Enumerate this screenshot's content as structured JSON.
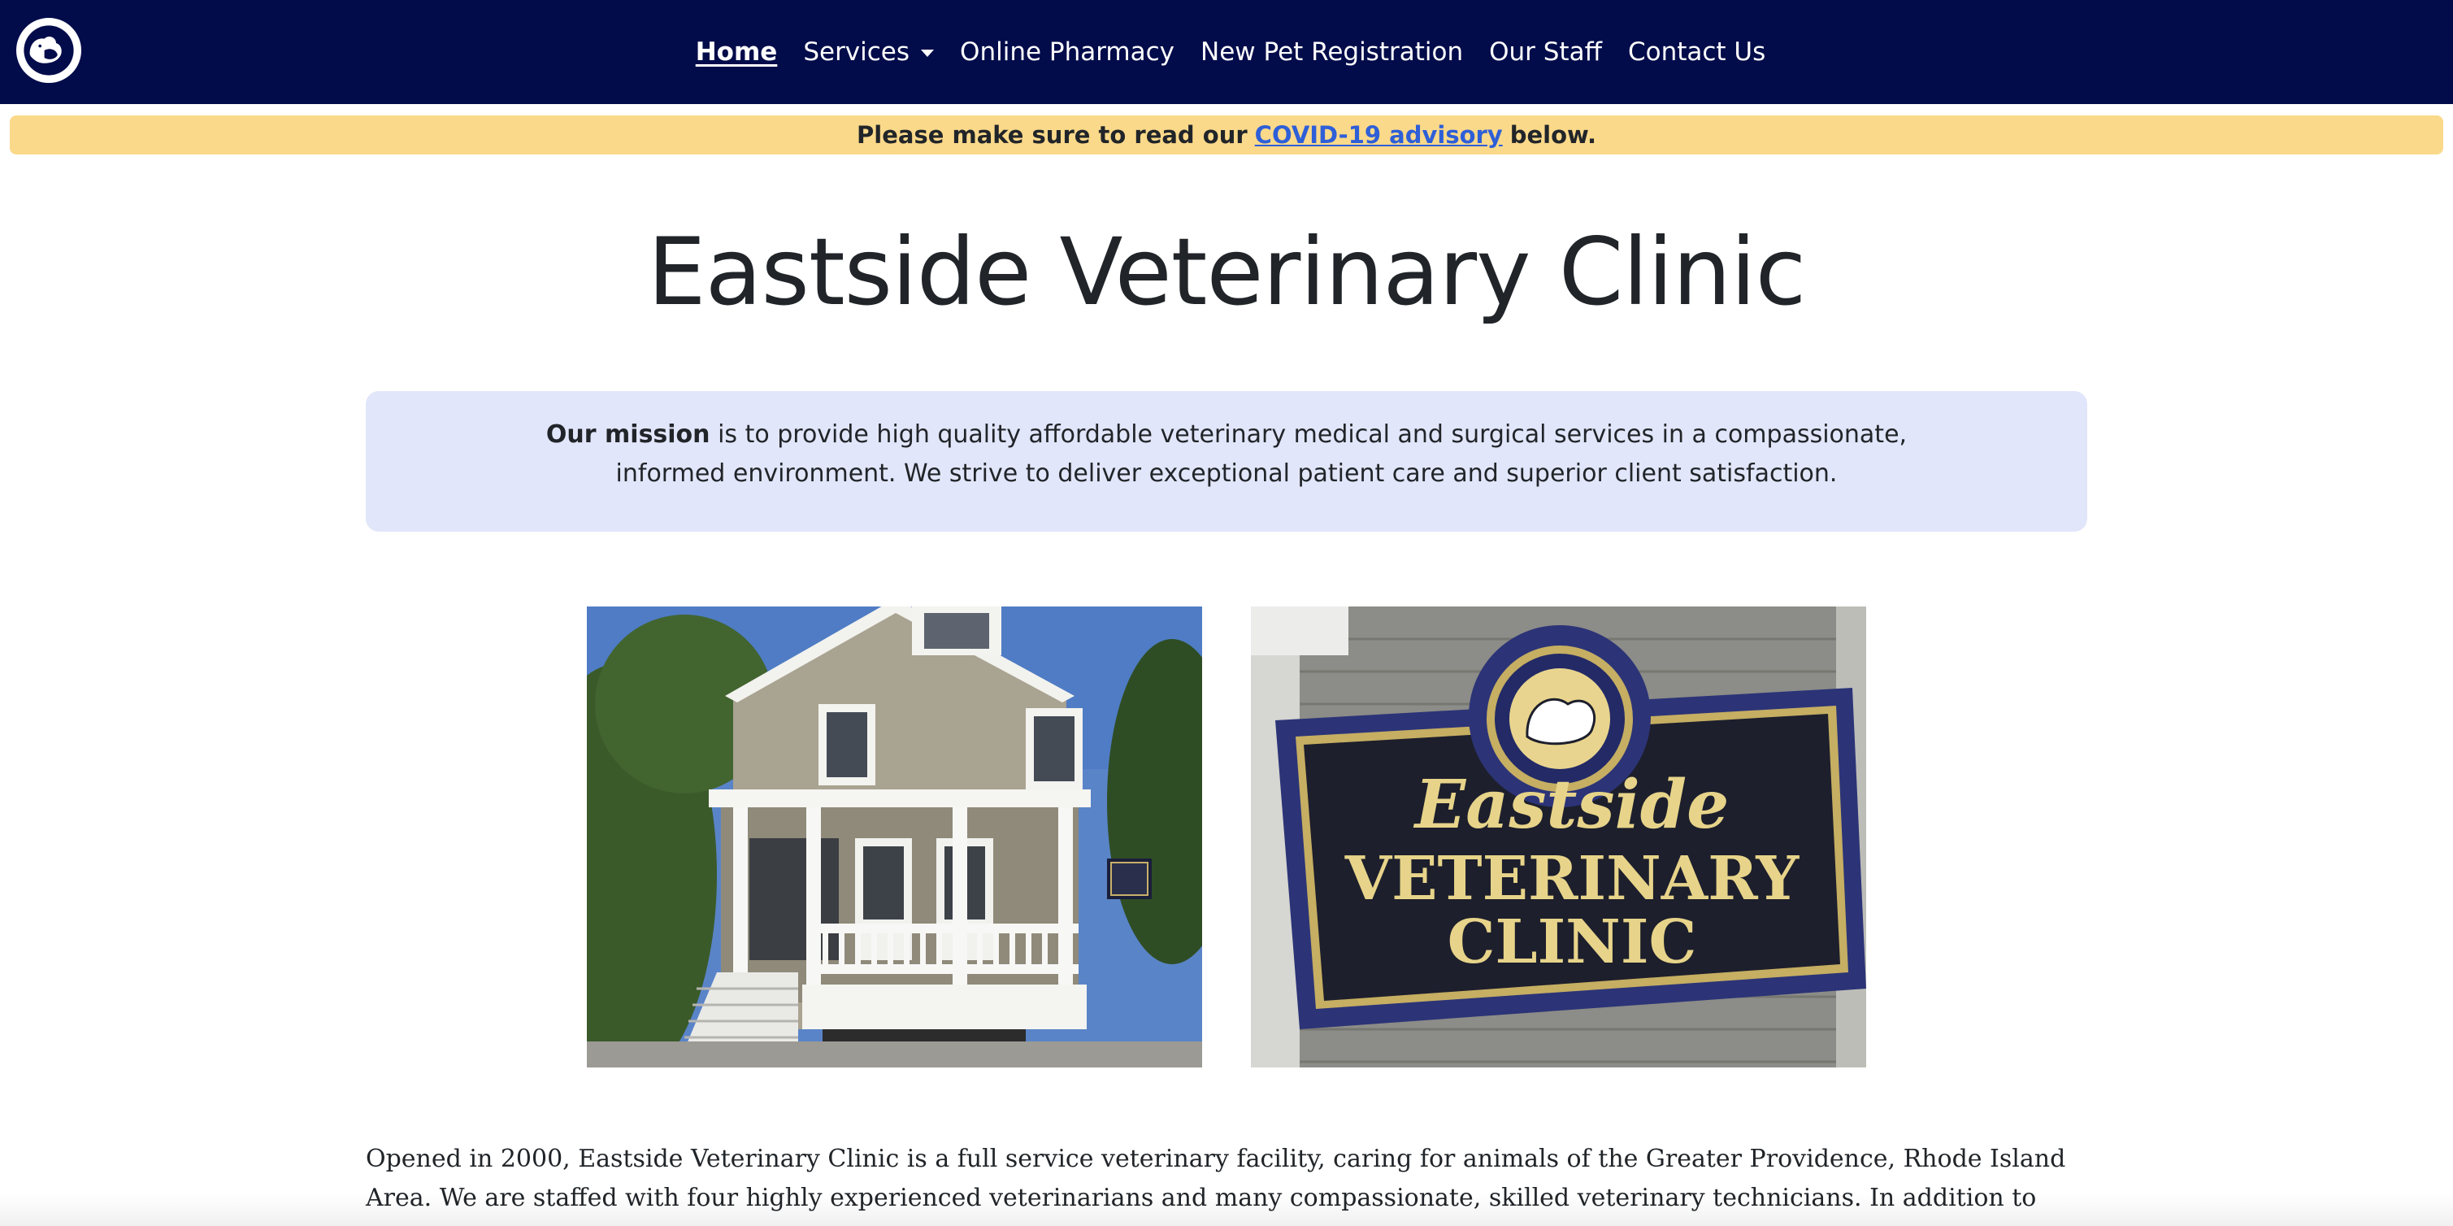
{
  "navbar": {
    "background": "#020c4a",
    "logo_icon": "dog-and-cat-logo",
    "items": [
      {
        "label": "Home",
        "active": true
      },
      {
        "label": "Services",
        "dropdown": true
      },
      {
        "label": "Online Pharmacy"
      },
      {
        "label": "New Pet Registration"
      },
      {
        "label": "Our Staff"
      },
      {
        "label": "Contact Us"
      }
    ]
  },
  "alert": {
    "background": "#fbd98a",
    "prefix": "Please make sure to read our",
    "link": "COVID-19 advisory",
    "suffix": "below."
  },
  "page": {
    "title": "Eastside Veterinary Clinic"
  },
  "mission": {
    "lead": "Our mission",
    "text": "is to provide high quality affordable veterinary medical and surgical services in a compassionate, informed environment. We strive to deliver exceptional patient care and superior client satisfaction."
  },
  "photos": {
    "sign": {
      "line1": "Eastside",
      "line2": "VETERINARY",
      "line3": "CLINIC"
    }
  },
  "intro": {
    "text": "Opened in 2000, Eastside Veterinary Clinic is a full service veterinary facility, caring for animals of the Greater Providence, Rhode Island Area. We are staffed with four highly experienced veterinarians and many compassionate, skilled veterinary technicians. In addition to providing services to"
  }
}
